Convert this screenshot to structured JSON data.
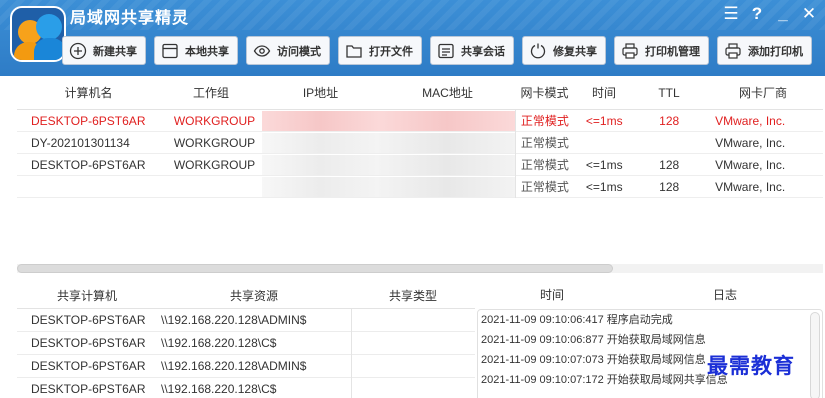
{
  "app": {
    "title": "局域网共享精灵"
  },
  "window_controls": {
    "menu": "☰",
    "help": "?",
    "minimize": "_",
    "close": "✕"
  },
  "toolbar": [
    {
      "label": "新建共享",
      "icon": "plus-circle-icon"
    },
    {
      "label": "本地共享",
      "icon": "window-icon"
    },
    {
      "label": "访问模式",
      "icon": "eye-icon"
    },
    {
      "label": "打开文件",
      "icon": "folder-icon"
    },
    {
      "label": "共享会话",
      "icon": "list-icon"
    },
    {
      "label": "修复共享",
      "icon": "refresh-icon"
    },
    {
      "label": "打印机管理",
      "icon": "printer-icon"
    },
    {
      "label": "添加打印机",
      "icon": "printer-add-icon"
    }
  ],
  "hosts_table": {
    "columns": [
      "计算机名",
      "工作组",
      "IP地址",
      "MAC地址",
      "网卡模式",
      "时间",
      "TTL",
      "网卡厂商"
    ],
    "rows": [
      {
        "name": "DESKTOP-6PST6AR",
        "workgroup": "WORKGROUP",
        "mode": "正常模式",
        "time": "<=1ms",
        "ttl": "128",
        "vendor": "VMware, Inc."
      },
      {
        "name": "DY-202101301134",
        "workgroup": "WORKGROUP",
        "mode": "正常模式",
        "time": "",
        "ttl": "",
        "vendor": "VMware, Inc."
      },
      {
        "name": "DESKTOP-6PST6AR",
        "workgroup": "WORKGROUP",
        "mode": "正常模式",
        "time": "<=1ms",
        "ttl": "128",
        "vendor": "VMware, Inc."
      },
      {
        "name": "",
        "workgroup": "",
        "mode": "正常模式",
        "time": "<=1ms",
        "ttl": "128",
        "vendor": "VMware, Inc."
      }
    ],
    "selected_row": 0,
    "selected_color": "#e01f1f"
  },
  "shares_table": {
    "columns": [
      "共享计算机",
      "共享资源",
      "共享类型"
    ],
    "rows": [
      {
        "computer": "DESKTOP-6PST6AR",
        "resource": "\\\\192.168.220.128\\ADMIN$",
        "type": ""
      },
      {
        "computer": "DESKTOP-6PST6AR",
        "resource": "\\\\192.168.220.128\\C$",
        "type": ""
      },
      {
        "computer": "DESKTOP-6PST6AR",
        "resource": "\\\\192.168.220.128\\ADMIN$",
        "type": ""
      },
      {
        "computer": "DESKTOP-6PST6AR",
        "resource": "\\\\192.168.220.128\\C$",
        "type": ""
      }
    ]
  },
  "log_panel": {
    "columns": [
      "时间",
      "日志"
    ],
    "entries": [
      {
        "time": "2021-11-09 09:10:06:417",
        "message": "程序启动完成"
      },
      {
        "time": "2021-11-09 09:10:06:877",
        "message": "开始获取局域网信息"
      },
      {
        "time": "2021-11-09 09:10:07:073",
        "message": "开始获取局域网信息"
      },
      {
        "time": "2021-11-09 09:10:07:172",
        "message": "开始获取局域网共享信息"
      }
    ]
  },
  "watermark": "最需教育",
  "colors": {
    "titlebar": "#2e7cc6",
    "accent_red": "#e01f1f",
    "watermark": "#1b2fd6"
  }
}
